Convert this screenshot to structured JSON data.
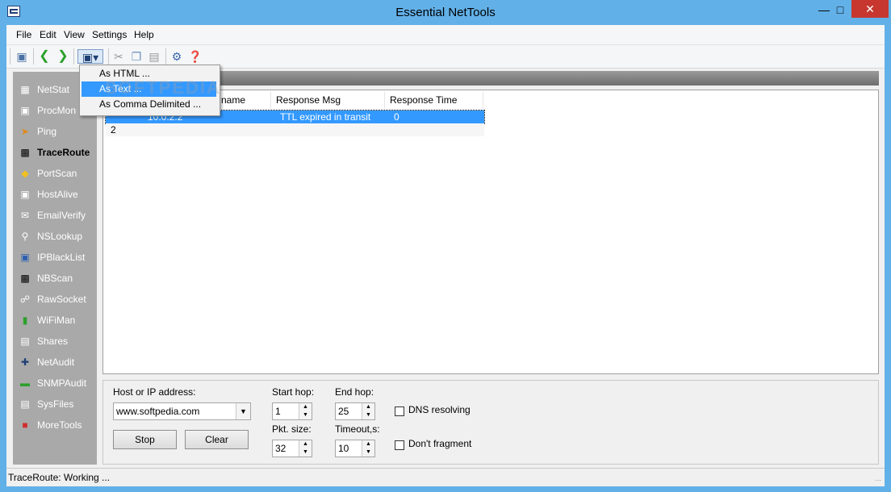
{
  "window": {
    "title": "Essential NetTools"
  },
  "menu": [
    "File",
    "Edit",
    "View",
    "Settings",
    "Help"
  ],
  "export_menu": {
    "items": [
      "As HTML ...",
      "As Text ...",
      "As Comma Delimited ..."
    ],
    "highlighted": "As Text ..."
  },
  "watermark": "SOFTPEDIA",
  "sidebar": {
    "items": [
      "NetStat",
      "ProcMon",
      "Ping",
      "TraceRoute",
      "PortScan",
      "HostAlive",
      "EmailVerify",
      "NSLookup",
      "IPBlackList",
      "NBScan",
      "RawSocket",
      "WiFiMan",
      "Shares",
      "NetAudit",
      "SNMPAudit",
      "SysFiles",
      "MoreTools"
    ],
    "active": "TraceRoute"
  },
  "table": {
    "columns": [
      "name",
      "Response Msg",
      "Response Time"
    ],
    "rows": [
      {
        "hop": "",
        "host": "10.0.2.2",
        "msg": "TTL expired in transit",
        "time": "0"
      },
      {
        "hop": "2",
        "host": "",
        "msg": "",
        "time": ""
      }
    ]
  },
  "form": {
    "host_label": "Host or IP address:",
    "host_value": "www.softpedia.com",
    "stop_label": "Stop",
    "clear_label": "Clear",
    "start_hop_label": "Start hop:",
    "start_hop_value": "1",
    "end_hop_label": "End hop:",
    "end_hop_value": "25",
    "pkt_size_label": "Pkt. size:",
    "pkt_size_value": "32",
    "timeout_label": "Timeout,s:",
    "timeout_value": "10",
    "dns_label": "DNS resolving",
    "fragment_label": "Don't fragment"
  },
  "status": {
    "text": "TraceRoute: Working ..."
  }
}
